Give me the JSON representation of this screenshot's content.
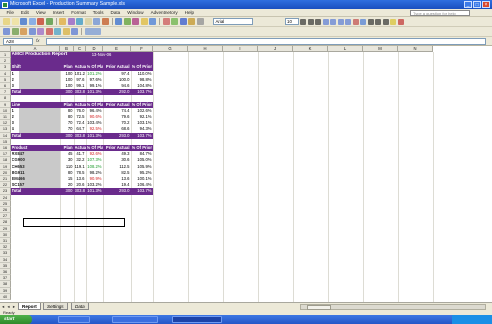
{
  "window": {
    "title": "Microsoft Excel - Production Summary Sample.xls"
  },
  "menu": [
    "File",
    "Edit",
    "View",
    "Insert",
    "Format",
    "Tools",
    "Data",
    "Window",
    "Adventnetory",
    "Help"
  ],
  "help_placeholder": "Type a question for help",
  "toolbar": {
    "font_name": "Arial",
    "font_size": "10"
  },
  "formula_bar": {
    "name_box": "A28",
    "fx": "fx"
  },
  "columns": [
    "A",
    "B",
    "C",
    "D",
    "E",
    "F",
    "G",
    "H",
    "I",
    "J",
    "K",
    "L",
    "M",
    "N"
  ],
  "report": {
    "title": "AMCI Production Report",
    "date": "13-Nov-06",
    "shift_header": "Shift",
    "col_headers": [
      "Plan",
      "Actual",
      "% Of Plan",
      "Prior Actual",
      "% Of Prior"
    ],
    "shift_rows": [
      {
        "label": "1",
        "plan": "100",
        "actual": "101.2",
        "pct_plan": "101.2%",
        "prior": "97.4",
        "pct_prior": "110.0%",
        "pct_color": "green"
      },
      {
        "label": "2",
        "plan": "100",
        "actual": "97.6",
        "pct_plan": "97.6%",
        "prior": "100.0",
        "pct_prior": "98.8%",
        "pct_color": "black"
      },
      {
        "label": "3",
        "plan": "100",
        "actual": "99.1",
        "pct_plan": "99.1%",
        "prior": "94.6",
        "pct_prior": "104.8%",
        "pct_color": "black"
      }
    ],
    "shift_total": {
      "label": "Total",
      "plan": "300",
      "actual": "303.8",
      "pct_plan": "101.3%",
      "prior": "292.0",
      "pct_prior": "103.7%"
    },
    "line_header": "Line",
    "line_rows": [
      {
        "label": "1",
        "plan": "80",
        "actual": "76.0",
        "pct_plan": "96.4%",
        "prior": "74.4",
        "pct_prior": "102.6%",
        "pct_color": "black"
      },
      {
        "label": "2",
        "plan": "80",
        "actual": "72.5",
        "pct_plan": "90.6%",
        "prior": "79.6",
        "pct_prior": "92.1%",
        "pct_color": "red"
      },
      {
        "label": "3",
        "plan": "70",
        "actual": "72.4",
        "pct_plan": "103.4%",
        "prior": "70.2",
        "pct_prior": "103.1%",
        "pct_color": "black"
      },
      {
        "label": "4",
        "plan": "70",
        "actual": "64.7",
        "pct_plan": "92.5%",
        "prior": "68.6",
        "pct_prior": "94.3%",
        "pct_color": "red"
      }
    ],
    "line_total": {
      "label": "Total",
      "plan": "300",
      "actual": "303.8",
      "pct_plan": "101.3%",
      "prior": "293.0",
      "pct_prior": "103.7%"
    },
    "product_header": "Product",
    "product_rows": [
      {
        "label": "RX847",
        "plan": "45",
        "actual": "41.7",
        "pct_plan": "92.6%",
        "prior": "49.3",
        "pct_prior": "84.7%",
        "pct_color": "red"
      },
      {
        "label": "CG900",
        "plan": "30",
        "actual": "32.2",
        "pct_plan": "107.3%",
        "prior": "30.6",
        "pct_prior": "105.0%",
        "pct_color": "green"
      },
      {
        "label": "CH653",
        "plan": "110",
        "actual": "119.1",
        "pct_plan": "108.2%",
        "prior": "112.5",
        "pct_prior": "105.9%",
        "pct_color": "green"
      },
      {
        "label": "BG911",
        "plan": "80",
        "actual": "78.5",
        "pct_plan": "98.2%",
        "prior": "82.5",
        "pct_prior": "95.2%",
        "pct_color": "black"
      },
      {
        "label": "EM466",
        "plan": "15",
        "actual": "13.6",
        "pct_plan": "90.9%",
        "prior": "13.6",
        "pct_prior": "100.1%",
        "pct_color": "red"
      },
      {
        "label": "SC157",
        "plan": "20",
        "actual": "20.6",
        "pct_plan": "103.2%",
        "prior": "19.4",
        "pct_prior": "106.4%",
        "pct_color": "black"
      }
    ],
    "product_total": {
      "label": "Total",
      "plan": "300",
      "actual": "303.8",
      "pct_plan": "101.3%",
      "prior": "293.0",
      "pct_prior": "103.7%"
    }
  },
  "sheets": {
    "nav": "◂ ◂ ▸ ▸",
    "tabs": [
      "Report",
      "Settings",
      "Data"
    ]
  },
  "status": "Ready",
  "taskbar": {
    "start": "start",
    "tray_time": ""
  }
}
